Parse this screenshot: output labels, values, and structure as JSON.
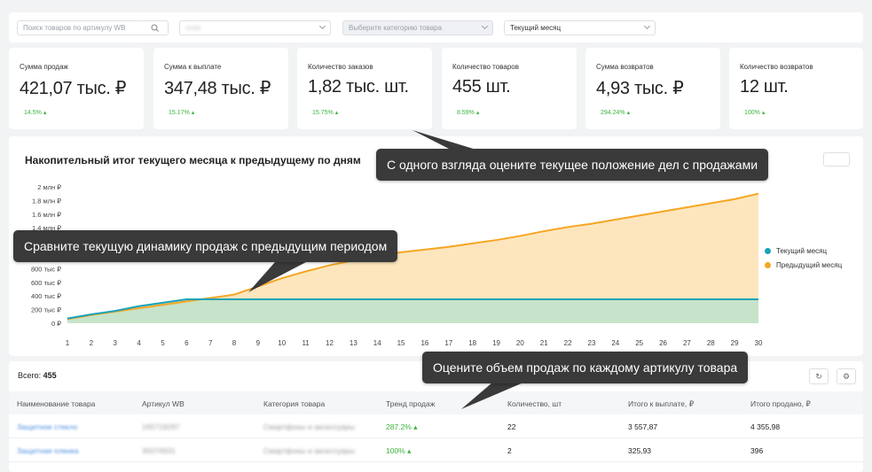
{
  "filters": {
    "search_placeholder": "Поиск товаров по артикулу WB",
    "store_value": "mobi",
    "category_placeholder": "Выберите категорию товара",
    "period_value": "Текущий месяц"
  },
  "kpis": [
    {
      "label": "Сумма продаж",
      "value": "421,07 тыс. ₽",
      "change": "14.5%"
    },
    {
      "label": "Сумма к выплате",
      "value": "347,48 тыс. ₽",
      "change": "15.17%"
    },
    {
      "label": "Количество заказов",
      "value": "1,82 тыс. шт.",
      "change": "15.75%"
    },
    {
      "label": "Количество товаров",
      "value": "455 шт.",
      "change": "8.59%"
    },
    {
      "label": "Сумма возвратов",
      "value": "4,93 тыс. ₽",
      "change": "294.24%"
    },
    {
      "label": "Количество возвратов",
      "value": "12 шт.",
      "change": "100%"
    }
  ],
  "chart_data": {
    "type": "area",
    "title": "Накопительный итог текущего месяца к предыдущему по дням",
    "x": [
      1,
      2,
      3,
      4,
      5,
      6,
      7,
      8,
      9,
      10,
      11,
      12,
      13,
      14,
      15,
      16,
      17,
      18,
      19,
      20,
      21,
      22,
      23,
      24,
      25,
      26,
      27,
      28,
      29,
      30
    ],
    "y_ticks": [
      "0 ₽",
      "200 тыс ₽",
      "400 тыс ₽",
      "600 тыс ₽",
      "800 тыс ₽",
      "1 млн ₽",
      "1.2 млн ₽",
      "1.4 млн ₽",
      "1.6 млн ₽",
      "1.8 млн ₽",
      "2 млн ₽"
    ],
    "ylim": [
      0,
      2000000
    ],
    "legend_position": "right",
    "series": [
      {
        "name": "Текущий месяц",
        "color": "#1aa3b8",
        "values": [
          70000,
          130000,
          180000,
          250000,
          300000,
          350000,
          350000,
          350000,
          350000,
          350000,
          350000,
          350000,
          350000,
          350000,
          350000,
          350000,
          350000,
          350000,
          350000,
          350000,
          350000,
          350000,
          350000,
          350000,
          350000,
          350000,
          350000,
          350000,
          350000,
          350000
        ]
      },
      {
        "name": "Предыдущий месяц",
        "color": "#f5a623",
        "values": [
          60000,
          120000,
          170000,
          220000,
          270000,
          320000,
          370000,
          420000,
          540000,
          660000,
          760000,
          850000,
          920000,
          990000,
          1040000,
          1080000,
          1120000,
          1170000,
          1220000,
          1280000,
          1350000,
          1410000,
          1460000,
          1520000,
          1580000,
          1640000,
          1700000,
          1760000,
          1820000,
          1900000
        ]
      }
    ]
  },
  "table": {
    "total_label": "Всего:",
    "total_value": "455",
    "headers": [
      "Наименование товара",
      "Артикул WB",
      "Категория товара",
      "Тренд продаж",
      "Количество, шт",
      "Итого к выплате, ₽",
      "Итого продано, ₽"
    ],
    "rows": [
      {
        "name": "Защитное стекло",
        "article": "165719297",
        "category": "Смартфоны и аксессуары",
        "trend": "287.2%",
        "qty": "22",
        "payout": "3 557,87",
        "sold": "4 355,98"
      },
      {
        "name": "Защитная пленка",
        "article": "35074931",
        "category": "Смартфоны и аксессуары",
        "trend": "100%",
        "qty": "2",
        "payout": "325,93",
        "sold": "396"
      }
    ]
  },
  "tooltips": {
    "overview": "С одного взгляда оцените текущее положение дел с продажами",
    "dynamics": "Сравните текущую динамику продаж с предыдущим периодом",
    "per_article": "Оцените объем продаж по каждому артикулу товара"
  },
  "colors": {
    "accent_green": "#3bb33b",
    "current": "#1aa3b8",
    "previous": "#f5a623",
    "tooltip_bg": "#3a3a3a"
  }
}
